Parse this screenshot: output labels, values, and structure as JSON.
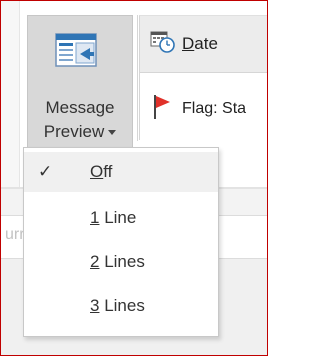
{
  "ribbon": {
    "message_preview": {
      "icon": "message-preview-icon",
      "line1": "Message",
      "line2": "Preview"
    },
    "arrangement": {
      "date": {
        "icon": "calendar-clock-icon",
        "mnemonic": "D",
        "rest": "ate"
      },
      "flag": {
        "icon": "red-flag-icon",
        "label": "Flag: Sta"
      }
    }
  },
  "search": {
    "placeholder_partial": "urrent Mailbox"
  },
  "menu": {
    "items": [
      {
        "mnemonic": "O",
        "rest": "ff",
        "checked": true
      },
      {
        "mnemonic": "1",
        "rest": " Line",
        "checked": false
      },
      {
        "mnemonic": "2",
        "rest": " Lines",
        "checked": false
      },
      {
        "mnemonic": "3",
        "rest": " Lines",
        "checked": false
      }
    ],
    "check_symbol": "✓"
  },
  "colors": {
    "accent_red": "#c00000",
    "flag_red": "#e0312a",
    "icon_blue": "#2f75b5"
  }
}
